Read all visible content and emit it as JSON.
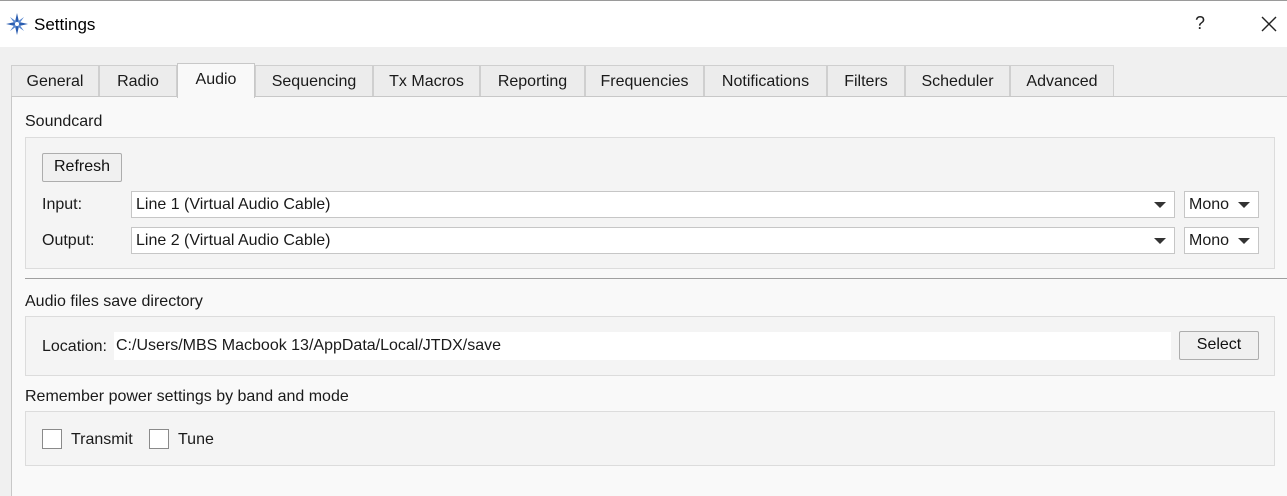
{
  "window": {
    "title": "Settings",
    "help_label": "?"
  },
  "tabs": [
    {
      "label": "General",
      "active": false
    },
    {
      "label": "Radio",
      "active": false
    },
    {
      "label": "Audio",
      "active": true
    },
    {
      "label": "Sequencing",
      "active": false
    },
    {
      "label": "Tx Macros",
      "active": false
    },
    {
      "label": "Reporting",
      "active": false
    },
    {
      "label": "Frequencies",
      "active": false
    },
    {
      "label": "Notifications",
      "active": false
    },
    {
      "label": "Filters",
      "active": false
    },
    {
      "label": "Scheduler",
      "active": false
    },
    {
      "label": "Advanced",
      "active": false
    }
  ],
  "soundcard": {
    "section_label": "Soundcard",
    "refresh_label": "Refresh",
    "input_label": "Input:",
    "input_value": "Line 1 (Virtual Audio Cable)",
    "input_channel": "Mono",
    "output_label": "Output:",
    "output_value": "Line 2 (Virtual Audio Cable)",
    "output_channel": "Mono"
  },
  "audio_files": {
    "section_label": "Audio files save directory",
    "location_label": "Location:",
    "location_value": "C:/Users/MBS Macbook 13/AppData/Local/JTDX/save",
    "select_label": "Select"
  },
  "power": {
    "section_label": "Remember power settings by band and mode",
    "transmit_label": "Transmit",
    "transmit_checked": false,
    "tune_label": "Tune",
    "tune_checked": false
  },
  "colors": {
    "icon_blue": "#2a5db0",
    "panel_bg": "#f9f9f9",
    "window_bg": "#f0f0f0"
  }
}
